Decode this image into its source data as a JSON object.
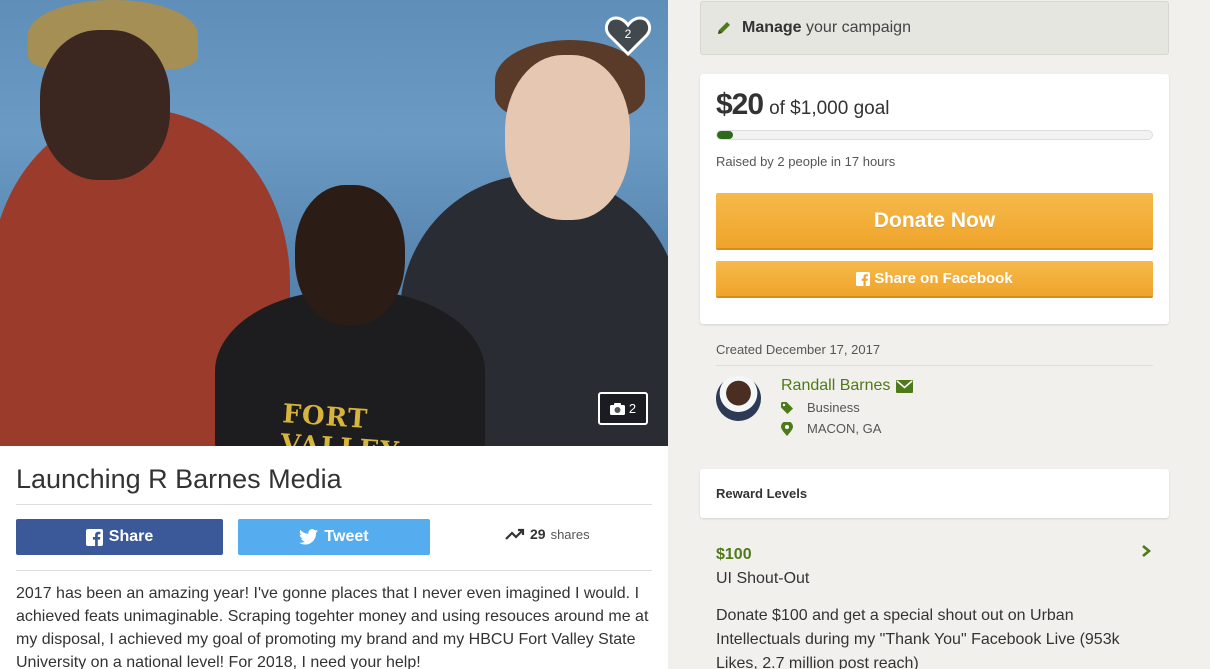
{
  "hero": {
    "favorites_count": "2",
    "photo_count": "2",
    "shirt_text": "FORT VALLEY STATE"
  },
  "campaign": {
    "title": "Launching R Barnes Media",
    "story": "2017 has been an amazing year! I've gonne places that I never even imagined I would. I achieved feats unimaginable. Scraping togehter money and using resouces around me at my disposal, I achieved my goal of promoting my brand and my HBCU Fort Valley State University on a national level! For 2018, I need your help!"
  },
  "share": {
    "facebook_label": "Share",
    "twitter_label": "Tweet",
    "shares_number": "29",
    "shares_word": "shares"
  },
  "manage": {
    "bold": "Manage",
    "rest": "your campaign"
  },
  "goal": {
    "raised": "$20",
    "goal_text": "of $1,000 goal",
    "progress_fraction": 0.02,
    "raised_by": "Raised by 2 people in 17 hours",
    "donate_label": "Donate Now",
    "fb_share_label": "Share on Facebook"
  },
  "organizer": {
    "created": "Created December 17, 2017",
    "name": "Randall Barnes",
    "category": "Business",
    "location": "MACON, GA"
  },
  "rewards": {
    "header": "Reward Levels",
    "items": [
      {
        "amount": "$100",
        "title": "UI Shout-Out",
        "description": "Donate $100 and get a special shout out on Urban Intellectuals during my \"Thank You\" Facebook Live (953k Likes, 2.7 million post reach)"
      }
    ]
  },
  "colors": {
    "accent_green": "#4f7a19",
    "progress_green": "#2e6a1b",
    "donate_orange": "#efa42a",
    "facebook_blue": "#3b5998",
    "twitter_blue": "#55acee"
  },
  "icons": [
    "heart-icon",
    "camera-icon",
    "facebook-icon",
    "twitter-icon",
    "trending-icon",
    "pencil-icon",
    "envelope-icon",
    "tag-icon",
    "map-pin-icon",
    "chevron-right-icon"
  ]
}
